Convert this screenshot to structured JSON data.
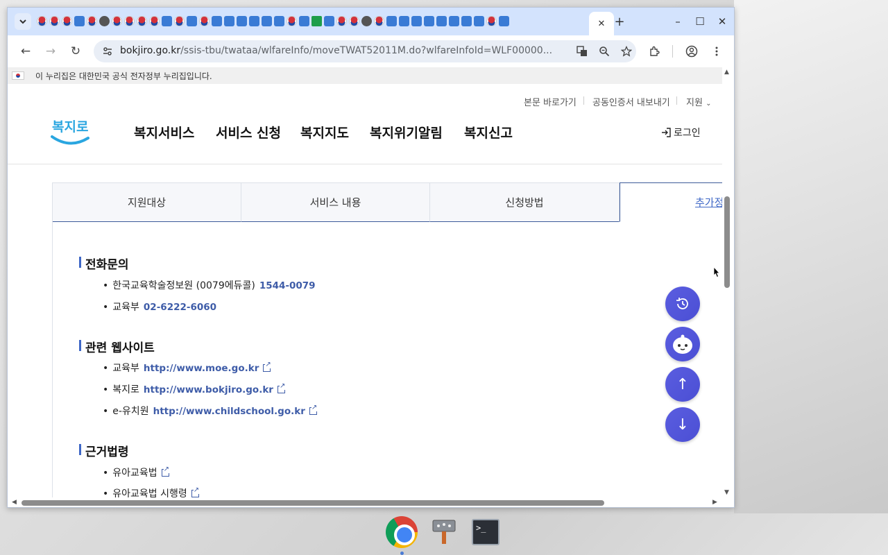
{
  "browser": {
    "url_domain": "bokjiro.go.kr",
    "url_path": "/ssis-tbu/twataa/wlfareInfo/moveTWAT52011M.do?wlfareInfoId=WLF00000...",
    "active_tab_close": "✕",
    "new_tab": "+",
    "minimize": "–",
    "maximize": "☐",
    "close": "✕",
    "back": "←",
    "forward": "→",
    "reload": "↻"
  },
  "gov_banner": "이 누리집은 대한민국 공식 전자정부 누리집입니다.",
  "utility": {
    "skip": "본문 바로가기",
    "cert": "공동인증서 내보내기",
    "support": "지원"
  },
  "logo_text": "복지로",
  "gnb": [
    "복지서비스",
    "서비스 신청",
    "복지지도",
    "복지위기알림",
    "복지신고"
  ],
  "login": "로그인",
  "tabs": [
    "지원대상",
    "서비스 내용",
    "신청방법",
    "추가정보"
  ],
  "sections": {
    "phone": {
      "title": "전화문의",
      "items": [
        {
          "label": "한국교육학술정보원 (0079에듀콜)",
          "value": "1544-0079"
        },
        {
          "label": "교육부",
          "value": "02-6222-6060"
        }
      ]
    },
    "sites": {
      "title": "관련 웹사이트",
      "items": [
        {
          "label": "교육부",
          "value": "http://www.moe.go.kr"
        },
        {
          "label": "복지로",
          "value": "http://www.bokjiro.go.kr"
        },
        {
          "label": "e-유치원",
          "value": "http://www.childschool.go.kr"
        }
      ]
    },
    "law": {
      "title": "근거법령",
      "items": [
        {
          "label": "유아교육법"
        },
        {
          "label": "유아교육법 시행령"
        }
      ]
    }
  },
  "fabs": {
    "history": "history-icon",
    "chatbot": "chatbot-icon",
    "top": "↑",
    "bottom": "↓"
  }
}
